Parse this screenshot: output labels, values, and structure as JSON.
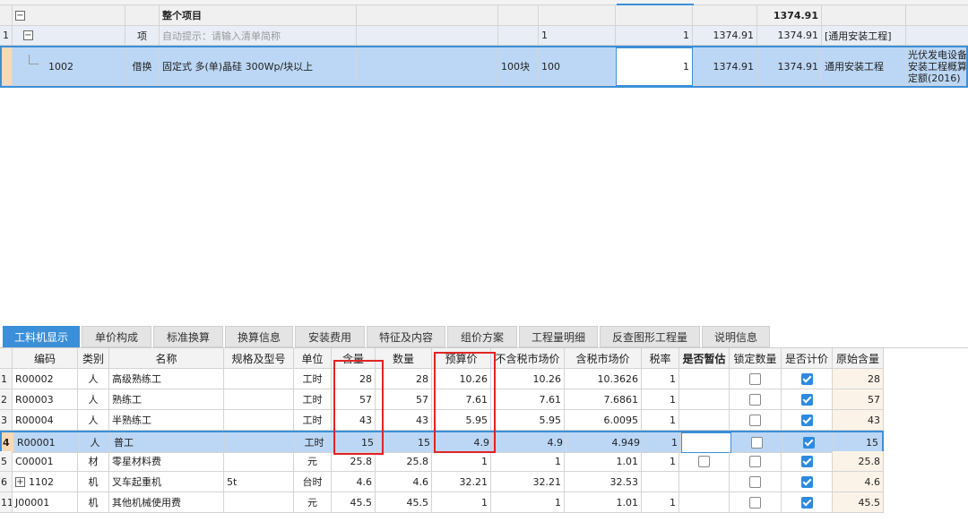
{
  "top_grid": {
    "rows": [
      {
        "row_no": "",
        "code": "",
        "type": "",
        "name": "整个项目",
        "unit": "",
        "qty_expr": "",
        "qty": "",
        "price": "",
        "total": "1374.91",
        "specialty": "",
        "extra": ""
      },
      {
        "row_no": "1",
        "code": "",
        "type": "项",
        "name": "自动提示：请输入清单简称",
        "unit": "",
        "qty_expr": "1",
        "qty": "1",
        "price": "1374.91",
        "total": "1374.91",
        "specialty": "[通用安装工程]",
        "extra": ""
      },
      {
        "row_no": "",
        "code": "1002",
        "type": "借换",
        "name": "固定式 多(单)晶硅 300Wp/块以上",
        "unit": "100块",
        "qty_expr": "100",
        "qty": "1",
        "price": "1374.91",
        "total": "1374.91",
        "specialty": "通用安装工程",
        "extra_lines": [
          "光伏发电设备",
          "安装工程概算",
          "定额(2016)"
        ]
      }
    ]
  },
  "tabs": [
    "工料机显示",
    "单价构成",
    "标准换算",
    "换算信息",
    "安装费用",
    "特征及内容",
    "组价方案",
    "工程量明细",
    "反查图形工程量",
    "说明信息"
  ],
  "bottom_grid": {
    "headers": [
      "",
      "编码",
      "类别",
      "名称",
      "规格及型号",
      "单位",
      "含量",
      "数量",
      "预算价",
      "不含税市场价",
      "含税市场价",
      "税率",
      "是否暂估",
      "锁定数量",
      "是否计价",
      "原始含量"
    ],
    "rows": [
      {
        "no": "1",
        "code": "R00002",
        "cat": "人",
        "name": "高级熟练工",
        "spec": "",
        "unit": "工时",
        "content": "28",
        "qty": "28",
        "budget": "10.26",
        "mkt_ex": "10.26",
        "mkt_in": "10.3626",
        "tax": "1",
        "provisional": "",
        "lock": false,
        "priced": true,
        "orig": "28"
      },
      {
        "no": "2",
        "code": "R00003",
        "cat": "人",
        "name": "熟练工",
        "spec": "",
        "unit": "工时",
        "content": "57",
        "qty": "57",
        "budget": "7.61",
        "mkt_ex": "7.61",
        "mkt_in": "7.6861",
        "tax": "1",
        "provisional": "",
        "lock": false,
        "priced": true,
        "orig": "57"
      },
      {
        "no": "3",
        "code": "R00004",
        "cat": "人",
        "name": "半熟练工",
        "spec": "",
        "unit": "工时",
        "content": "43",
        "qty": "43",
        "budget": "5.95",
        "mkt_ex": "5.95",
        "mkt_in": "6.0095",
        "tax": "1",
        "provisional": "",
        "lock": false,
        "priced": true,
        "orig": "43"
      },
      {
        "no": "4",
        "code": "R00001",
        "cat": "人",
        "name": "普工",
        "spec": "",
        "unit": "工时",
        "content": "15",
        "qty": "15",
        "budget": "4.9",
        "mkt_ex": "4.9",
        "mkt_in": "4.949",
        "tax": "1",
        "provisional": "",
        "lock": false,
        "priced": true,
        "orig": "15"
      },
      {
        "no": "5",
        "code": "C00001",
        "cat": "材",
        "name": "零星材料费",
        "spec": "",
        "unit": "元",
        "content": "25.8",
        "qty": "25.8",
        "budget": "1",
        "mkt_ex": "1",
        "mkt_in": "1.01",
        "tax": "1",
        "provisional": "box",
        "lock": false,
        "priced": true,
        "orig": "25.8"
      },
      {
        "no": "6",
        "code": "1102",
        "cat": "机",
        "name": "叉车起重机",
        "spec": "5t",
        "unit": "台时",
        "content": "4.6",
        "qty": "4.6",
        "budget": "32.21",
        "mkt_ex": "32.21",
        "mkt_in": "32.53",
        "tax": "",
        "provisional": "",
        "lock": false,
        "priced": true,
        "orig": "4.6"
      },
      {
        "no": "11",
        "code": "J00001",
        "cat": "机",
        "name": "其他机械使用费",
        "spec": "",
        "unit": "元",
        "content": "45.5",
        "qty": "45.5",
        "budget": "1",
        "mkt_ex": "1",
        "mkt_in": "1.01",
        "tax": "1",
        "provisional": "",
        "lock": false,
        "priced": true,
        "orig": "45.5"
      }
    ]
  },
  "colors": {
    "accent": "#3b8fd8",
    "selection": "#bcd7f5",
    "highlight_box": "#e02424"
  }
}
